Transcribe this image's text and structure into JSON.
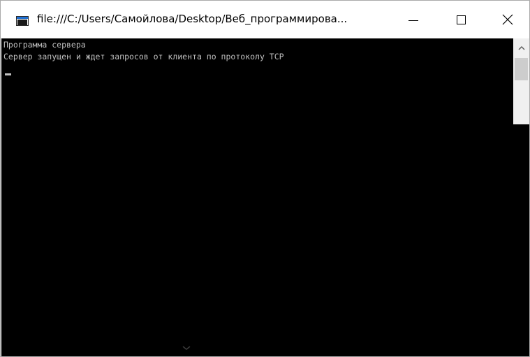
{
  "window": {
    "title": "file:///C:/Users/Самойлова/Desktop/Веб_программирова...",
    "icon": "console-app-icon",
    "caption_buttons": [
      "minimize-icon",
      "maximize-icon",
      "close-icon"
    ]
  },
  "console": {
    "lines": [
      "Программа сервера",
      "Сервер запущен и ждет запросов от клиента по протоколу TCP"
    ],
    "background": "#000000",
    "text_color": "#c0c0c0"
  },
  "scrollbar": {
    "up_icon": "chevron-up-icon"
  },
  "colors": {
    "titlebar": "#ffffff",
    "title_text": "#000000",
    "scrollbar_track": "#f0f0f0",
    "scrollbar_thumb": "#cdcdcd"
  }
}
